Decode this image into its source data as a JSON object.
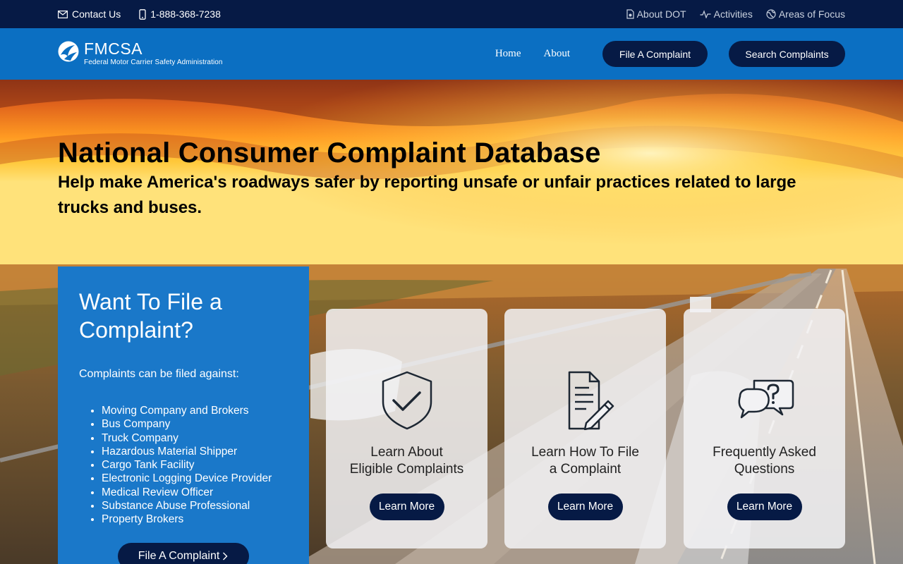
{
  "utility": {
    "contact_label": "Contact Us",
    "phone_label": "1-888-368-7238",
    "about_dot_label": "About DOT",
    "activities_label": "Activities",
    "areas_label": "Areas of Focus"
  },
  "header": {
    "logo_name": "FMCSA",
    "logo_subtitle": "Federal Motor Carrier Safety Administration",
    "nav_home": "Home",
    "nav_about": "About",
    "file_button": "File A Complaint",
    "search_button": "Search Complaints"
  },
  "hero": {
    "title": "National Consumer Complaint Database",
    "subtitle": "Help make America's roadways safer by reporting unsafe or unfair practices related to large trucks and buses."
  },
  "panel": {
    "title": "Want To File a Complaint?",
    "intro": "Complaints can be filed against:",
    "items": [
      "Moving Company and Brokers",
      "Bus Company",
      "Truck Company",
      "Hazardous Material Shipper",
      "Cargo Tank Facility",
      "Electronic Logging Device Provider",
      "Medical Review Officer",
      "Substance Abuse Professional",
      "Property Brokers"
    ],
    "button": "File A Complaint",
    "button_icon": "chevron-right-icon"
  },
  "cards": [
    {
      "title_line1": "Learn About",
      "title_line2": "Eligible Complaints",
      "button": "Learn More",
      "icon": "shield-check-icon"
    },
    {
      "title_line1": "Learn How To File",
      "title_line2": "a Complaint",
      "button": "Learn More",
      "icon": "document-pencil-icon"
    },
    {
      "title_line1": "Frequently Asked",
      "title_line2": "Questions",
      "button": "Learn More",
      "icon": "chat-question-icon"
    }
  ],
  "colors": {
    "utility_bar": "#061a45",
    "header": "#0b6fc2",
    "panel": "#1a78c9",
    "button": "#061a45"
  }
}
